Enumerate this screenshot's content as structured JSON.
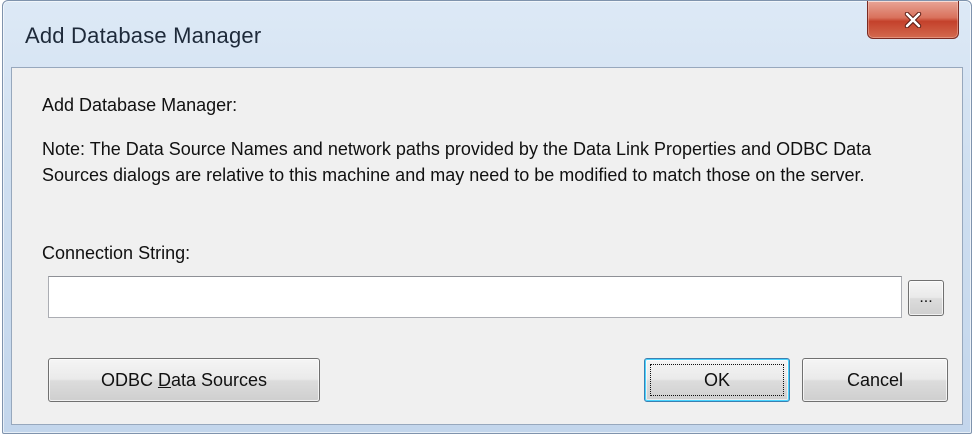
{
  "window": {
    "title": "Add Database Manager",
    "close_icon": "close-icon"
  },
  "dialog": {
    "heading": "Add Database Manager:",
    "note": "Note: The Data Source Names and network paths provided by the Data Link Properties and ODBC Data Sources dialogs are relative to this machine and may need to be modified to match those on the server.",
    "connection_label": "Connection String:",
    "connection_value": "",
    "browse_label": "...",
    "odbc_button": {
      "before": "ODBC ",
      "mnemonic": "D",
      "after": "ata Sources"
    },
    "ok_label": "OK",
    "cancel_label": "Cancel"
  },
  "colors": {
    "close_button": "#c4412b",
    "client_background": "#f0f0f0",
    "default_button_border": "#3c7fb1"
  }
}
